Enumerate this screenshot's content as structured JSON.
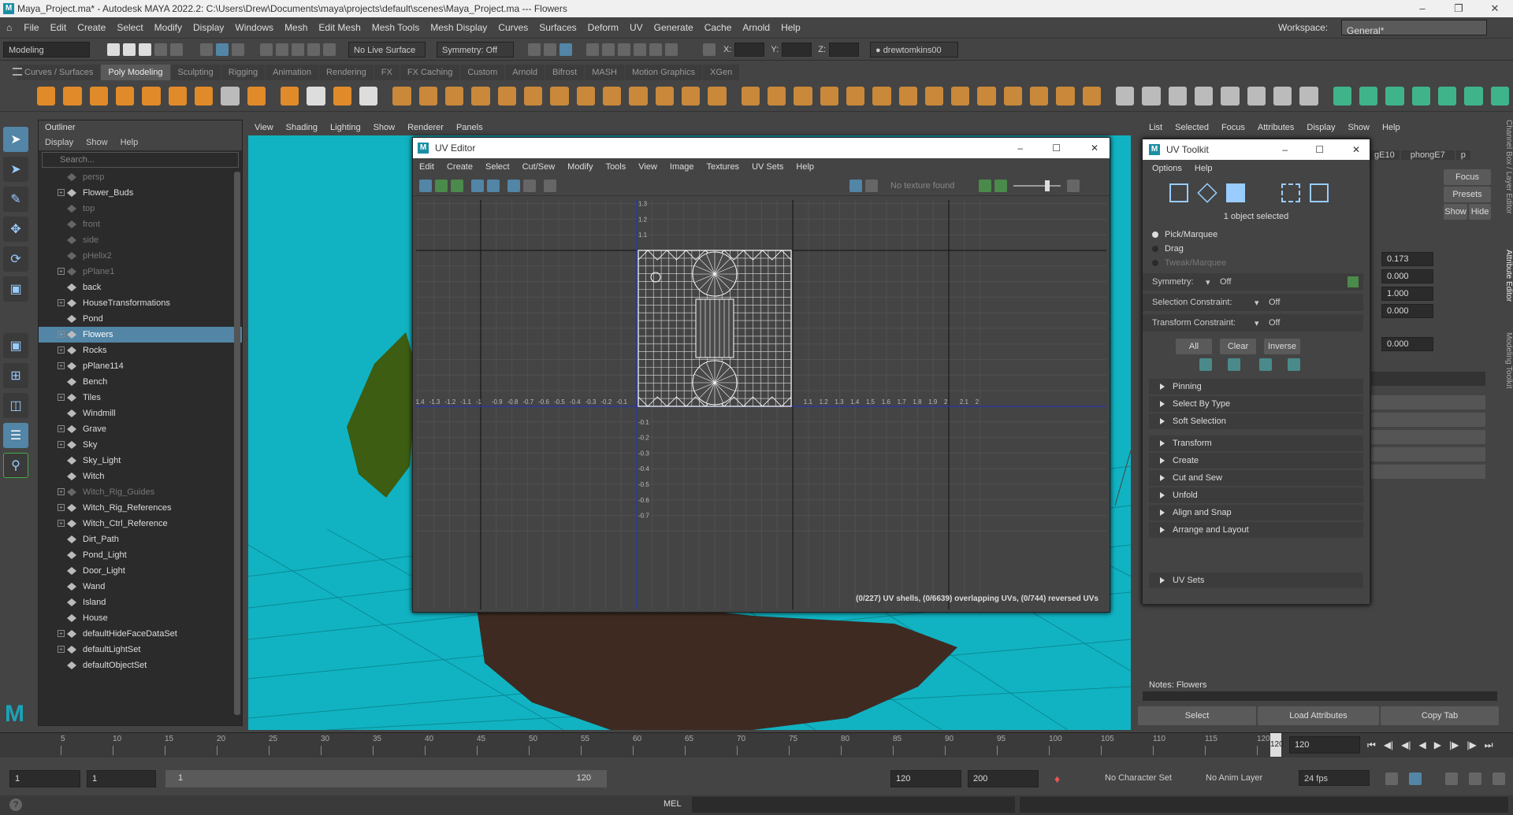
{
  "window": {
    "title": "Maya_Project.ma* - Autodesk MAYA 2022.2: C:\\Users\\Drew\\Documents\\maya\\projects\\default\\scenes\\Maya_Project.ma  ---  Flowers"
  },
  "menubar": [
    "File",
    "Edit",
    "Create",
    "Select",
    "Modify",
    "Display",
    "Windows",
    "Mesh",
    "Edit Mesh",
    "Mesh Tools",
    "Mesh Display",
    "Curves",
    "Surfaces",
    "Deform",
    "UV",
    "Generate",
    "Cache",
    "Arnold",
    "Help"
  ],
  "workspace": {
    "label": "Workspace:",
    "value": "General*"
  },
  "statusline": {
    "mode": "Modeling",
    "live_surface": "No Live Surface",
    "symmetry": "Symmetry: Off",
    "x": "X:",
    "y": "Y:",
    "z": "Z:",
    "user": "drewtomkins00"
  },
  "shelf_tabs": [
    "Curves / Surfaces",
    "Poly Modeling",
    "Sculpting",
    "Rigging",
    "Animation",
    "Rendering",
    "FX",
    "FX Caching",
    "Custom",
    "Arnold",
    "Bifrost",
    "MASH",
    "Motion Graphics",
    "XGen"
  ],
  "shelf_active": "Poly Modeling",
  "outliner": {
    "title": "Outliner",
    "menus": [
      "Display",
      "Show",
      "Help"
    ],
    "search_placeholder": "Search...",
    "items": [
      {
        "label": "persp",
        "dim": true,
        "plus": false
      },
      {
        "label": "Flower_Buds",
        "dim": false,
        "plus": true
      },
      {
        "label": "top",
        "dim": true,
        "plus": false
      },
      {
        "label": "front",
        "dim": true,
        "plus": false
      },
      {
        "label": "side",
        "dim": true,
        "plus": false
      },
      {
        "label": "pHelix2",
        "dim": true,
        "plus": false
      },
      {
        "label": "pPlane1",
        "dim": true,
        "plus": true
      },
      {
        "label": "back",
        "dim": false,
        "plus": false
      },
      {
        "label": "HouseTransformations",
        "dim": false,
        "plus": true
      },
      {
        "label": "Pond",
        "dim": false,
        "plus": false
      },
      {
        "label": "Flowers",
        "dim": false,
        "plus": true,
        "selected": true
      },
      {
        "label": "Rocks",
        "dim": false,
        "plus": true
      },
      {
        "label": "pPlane114",
        "dim": false,
        "plus": true
      },
      {
        "label": "Bench",
        "dim": false,
        "plus": false
      },
      {
        "label": "Tiles",
        "dim": false,
        "plus": true
      },
      {
        "label": "Windmill",
        "dim": false,
        "plus": false
      },
      {
        "label": "Grave",
        "dim": false,
        "plus": true
      },
      {
        "label": "Sky",
        "dim": false,
        "plus": true
      },
      {
        "label": "Sky_Light",
        "dim": false,
        "plus": false
      },
      {
        "label": "Witch",
        "dim": false,
        "plus": false
      },
      {
        "label": "Witch_Rig_Guides",
        "dim": true,
        "plus": true
      },
      {
        "label": "Witch_Rig_References",
        "dim": false,
        "plus": true
      },
      {
        "label": "Witch_Ctrl_Reference",
        "dim": false,
        "plus": true
      },
      {
        "label": "Dirt_Path",
        "dim": false,
        "plus": false
      },
      {
        "label": "Pond_Light",
        "dim": false,
        "plus": false
      },
      {
        "label": "Door_Light",
        "dim": false,
        "plus": false
      },
      {
        "label": "Wand",
        "dim": false,
        "plus": false
      },
      {
        "label": "Island",
        "dim": false,
        "plus": false
      },
      {
        "label": "House",
        "dim": false,
        "plus": false
      },
      {
        "label": "defaultHideFaceDataSet",
        "dim": false,
        "plus": true
      },
      {
        "label": "defaultLightSet",
        "dim": false,
        "plus": true
      },
      {
        "label": "defaultObjectSet",
        "dim": false,
        "plus": false
      }
    ]
  },
  "viewport_menu": [
    "View",
    "Shading",
    "Lighting",
    "Show",
    "Renderer",
    "Panels"
  ],
  "uv_editor": {
    "title": "UV Editor",
    "menus": [
      "Edit",
      "Create",
      "Select",
      "Cut/Sew",
      "Modify",
      "Tools",
      "View",
      "Image",
      "Textures",
      "UV Sets",
      "Help"
    ],
    "texture": "No texture found",
    "status": "(0/227) UV shells, (0/6639) overlapping UVs, (0/744) reversed UVs",
    "x_ticks": [
      "-1.4",
      "-1.3",
      "-1.2",
      "-1.1",
      "-1",
      "-0.9",
      "-0.8",
      "-0.7",
      "-0.6",
      "-0.5",
      "-0.4",
      "-0.3",
      "-0.2",
      "-0.1",
      "1.1",
      "1.2",
      "1.3",
      "1.4",
      "1.5",
      "1.6",
      "1.7",
      "1.8",
      "1.9",
      "2",
      "2.1",
      "2"
    ],
    "y_ticks": [
      "1.3",
      "1.2",
      "1.1",
      "-0.1",
      "-0.2",
      "-0.3",
      "-0.4",
      "-0.5",
      "-0.6",
      "-0.7"
    ]
  },
  "uv_toolkit": {
    "title": "UV Toolkit",
    "menus": [
      "Options",
      "Help"
    ],
    "selected": "1 object selected",
    "modes": [
      "Pick/Marquee",
      "Drag",
      "Tweak/Marquee"
    ],
    "symmetry_label": "Symmetry:",
    "symmetry_value": "Off",
    "selection_constraint_label": "Selection Constraint:",
    "selection_constraint_value": "Off",
    "transform_constraint_label": "Transform Constraint:",
    "transform_constraint_value": "Off",
    "buttons": [
      "All",
      "Clear",
      "Inverse"
    ],
    "sections1": [
      "Pinning",
      "Select By Type",
      "Soft Selection"
    ],
    "sections2": [
      "Transform",
      "Create",
      "Cut and Sew",
      "Unfold",
      "Align and Snap",
      "Arrange and Layout"
    ],
    "uvsets": "UV Sets"
  },
  "attr_editor": {
    "menus": [
      "List",
      "Selected",
      "Focus",
      "Attributes",
      "Display",
      "Show",
      "Help"
    ],
    "tabs": [
      "gE10",
      "phongE7",
      "p"
    ],
    "focus": "Focus",
    "presets": "Presets",
    "show": "Show",
    "hide": "Hide",
    "values": [
      "0.173",
      "0.000",
      "1.000",
      "0.000",
      "0.000"
    ],
    "notes": "Notes:  Flowers",
    "bottom_buttons": [
      "Select",
      "Load Attributes",
      "Copy Tab"
    ],
    "side_tabs": [
      "Channel Box / Layer Editor",
      "Attribute Editor",
      "Modeling Toolkit"
    ]
  },
  "timeline": {
    "ticks": [
      "5",
      "10",
      "15",
      "20",
      "25",
      "30",
      "35",
      "40",
      "45",
      "50",
      "55",
      "60",
      "65",
      "70",
      "75",
      "80",
      "85",
      "90",
      "95",
      "100",
      "105",
      "110",
      "115",
      "120"
    ],
    "current": "120",
    "current_field": "120"
  },
  "range": {
    "start": "1",
    "start2": "1",
    "range_start": "1",
    "range_end": "120",
    "end": "120",
    "end2": "200",
    "character_set": "No Character Set",
    "anim_layer": "No Anim Layer",
    "fps": "24 fps"
  },
  "cmdline": {
    "lang": "MEL"
  }
}
